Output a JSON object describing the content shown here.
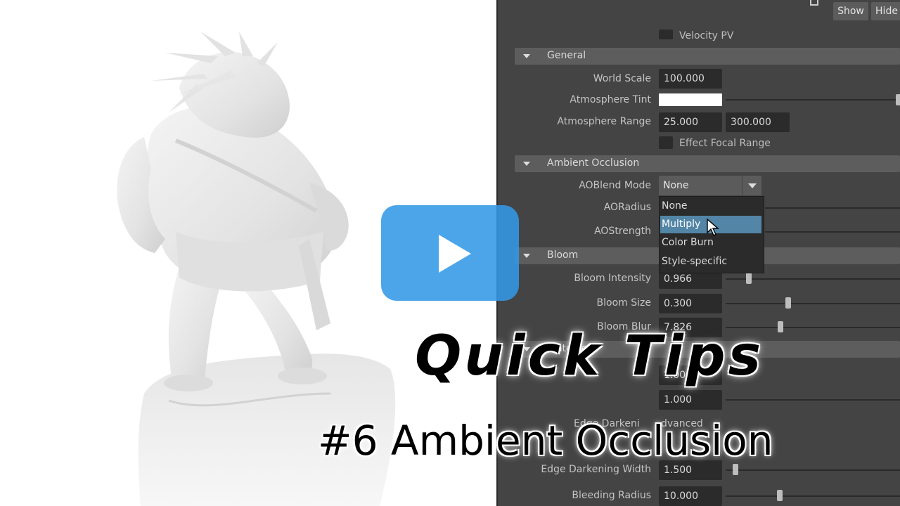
{
  "header": {
    "show_label": "Show",
    "hide_label": "Hide"
  },
  "velocity_pv": {
    "label": "Velocity PV"
  },
  "general": {
    "title": "General",
    "world_scale": {
      "label": "World Scale",
      "value": "100.000"
    },
    "atmosphere_tint": {
      "label": "Atmosphere Tint",
      "color": "#ffffff"
    },
    "atmosphere_range": {
      "label": "Atmosphere Range",
      "value_min": "25.000",
      "value_max": "300.000"
    },
    "effect_focal_range": {
      "label": "Effect Focal Range"
    }
  },
  "ambient_occlusion": {
    "title": "Ambient Occlusion",
    "ao_blend_mode": {
      "label": "AOBlend Mode",
      "value": "None",
      "options": [
        "None",
        "Multiply",
        "Color Burn",
        "Style-specific"
      ],
      "highlighted": "Multiply"
    },
    "ao_radius": {
      "label": "AORadius"
    },
    "ao_strength": {
      "label": "AOStrength"
    }
  },
  "bloom": {
    "title": "Bloom",
    "intensity": {
      "label": "Bloom Intensity",
      "value": "0.966"
    },
    "size": {
      "label": "Bloom Size",
      "value": "0.300"
    },
    "blur": {
      "label": "Bloom Blur",
      "value": "7.826"
    }
  },
  "watercolor": {
    "title_partial": "Watercolo",
    "field1_value": "1.000",
    "field2_value": "1.000",
    "edge_darkening_partial": "Edge Darkeni",
    "advanced_partial": "dvanced",
    "edge_darkening_width": {
      "label": "Edge Darkening Width",
      "value": "1.500"
    },
    "bleeding_radius": {
      "label": "Bleeding Radius",
      "value": "10.000"
    }
  },
  "overlay": {
    "title": "Quick Tips",
    "subtitle": "#6 Ambient Occlusion"
  },
  "colors": {
    "panel_bg": "#444444",
    "field_bg": "#2b2b2b",
    "highlight": "#5285a6",
    "play_button": "#3498e6"
  },
  "icons": [
    "play-icon",
    "mouse-cursor-icon",
    "dropdown-arrow-icon",
    "collapse-triangle-icon"
  ]
}
